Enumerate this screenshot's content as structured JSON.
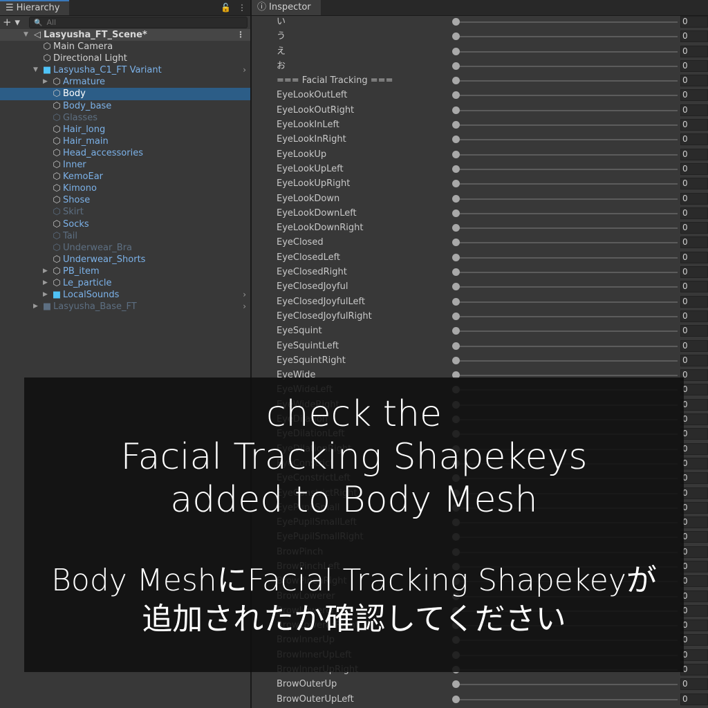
{
  "hierarchy": {
    "tab_label": "Hierarchy",
    "search_placeholder": "All",
    "rows": [
      {
        "label": "Lasyusha_FT_Scene*",
        "indent": 0,
        "icon": "unity",
        "arrow": "down",
        "style": "scene"
      },
      {
        "label": "Main Camera",
        "indent": 1,
        "icon": "cube",
        "arrow": "",
        "style": ""
      },
      {
        "label": "Directional Light",
        "indent": 1,
        "icon": "cube",
        "arrow": "",
        "style": ""
      },
      {
        "label": "Lasyusha_C1_FT Variant",
        "indent": 1,
        "icon": "prefab",
        "arrow": "down",
        "style": "blue",
        "chev": true
      },
      {
        "label": "Armature",
        "indent": 2,
        "icon": "cube",
        "arrow": "right",
        "style": "blue"
      },
      {
        "label": "Body",
        "indent": 2,
        "icon": "cube",
        "arrow": "",
        "style": "sel"
      },
      {
        "label": "Body_base",
        "indent": 2,
        "icon": "cube",
        "arrow": "",
        "style": "blue"
      },
      {
        "label": "Glasses",
        "indent": 2,
        "icon": "cube",
        "arrow": "",
        "style": "dim"
      },
      {
        "label": "Hair_long",
        "indent": 2,
        "icon": "cube",
        "arrow": "",
        "style": "blue"
      },
      {
        "label": "Hair_main",
        "indent": 2,
        "icon": "cube",
        "arrow": "",
        "style": "blue"
      },
      {
        "label": "Head_accessories",
        "indent": 2,
        "icon": "cube",
        "arrow": "",
        "style": "blue"
      },
      {
        "label": "Inner",
        "indent": 2,
        "icon": "cube",
        "arrow": "",
        "style": "blue"
      },
      {
        "label": "KemoEar",
        "indent": 2,
        "icon": "cube",
        "arrow": "",
        "style": "blue"
      },
      {
        "label": "Kimono",
        "indent": 2,
        "icon": "cube",
        "arrow": "",
        "style": "blue"
      },
      {
        "label": "Shose",
        "indent": 2,
        "icon": "cube",
        "arrow": "",
        "style": "blue"
      },
      {
        "label": "Skirt",
        "indent": 2,
        "icon": "cube",
        "arrow": "",
        "style": "dim"
      },
      {
        "label": "Socks",
        "indent": 2,
        "icon": "cube",
        "arrow": "",
        "style": "blue"
      },
      {
        "label": "Tail",
        "indent": 2,
        "icon": "cube",
        "arrow": "",
        "style": "dim"
      },
      {
        "label": "Underwear_Bra",
        "indent": 2,
        "icon": "cube",
        "arrow": "",
        "style": "dim"
      },
      {
        "label": "Underwear_Shorts",
        "indent": 2,
        "icon": "cube",
        "arrow": "",
        "style": "blue"
      },
      {
        "label": "PB_item",
        "indent": 2,
        "icon": "cube",
        "arrow": "right",
        "style": "blue"
      },
      {
        "label": "Le_particle",
        "indent": 2,
        "icon": "cube",
        "arrow": "right",
        "style": "blue"
      },
      {
        "label": "LocalSounds",
        "indent": 2,
        "icon": "prefab",
        "arrow": "right",
        "style": "blue",
        "chev": true
      },
      {
        "label": "Lasyusha_Base_FT",
        "indent": 1,
        "icon": "prefab",
        "arrow": "right",
        "style": "dim",
        "chev": true
      }
    ]
  },
  "inspector": {
    "tab_label": "Inspector",
    "blendshapes": [
      {
        "name": "い",
        "value": "0"
      },
      {
        "name": "う",
        "value": "0"
      },
      {
        "name": "え",
        "value": "0"
      },
      {
        "name": "お",
        "value": "0"
      },
      {
        "name": "=== Facial Tracking ===",
        "value": "0"
      },
      {
        "name": "EyeLookOutLeft",
        "value": "0"
      },
      {
        "name": "EyeLookOutRight",
        "value": "0"
      },
      {
        "name": "EyeLookInLeft",
        "value": "0"
      },
      {
        "name": "EyeLookInRight",
        "value": "0"
      },
      {
        "name": "EyeLookUp",
        "value": "0"
      },
      {
        "name": "EyeLookUpLeft",
        "value": "0"
      },
      {
        "name": "EyeLookUpRight",
        "value": "0"
      },
      {
        "name": "EyeLookDown",
        "value": "0"
      },
      {
        "name": "EyeLookDownLeft",
        "value": "0"
      },
      {
        "name": "EyeLookDownRight",
        "value": "0"
      },
      {
        "name": "EyeClosed",
        "value": "0"
      },
      {
        "name": "EyeClosedLeft",
        "value": "0"
      },
      {
        "name": "EyeClosedRight",
        "value": "0"
      },
      {
        "name": "EyeClosedJoyful",
        "value": "0"
      },
      {
        "name": "EyeClosedJoyfulLeft",
        "value": "0"
      },
      {
        "name": "EyeClosedJoyfulRight",
        "value": "0"
      },
      {
        "name": "EyeSquint",
        "value": "0"
      },
      {
        "name": "EyeSquintLeft",
        "value": "0"
      },
      {
        "name": "EyeSquintRight",
        "value": "0"
      },
      {
        "name": "EyeWide",
        "value": "0"
      },
      {
        "name": "EyeWideLeft",
        "value": "0"
      },
      {
        "name": "EyeWideRight",
        "value": "0"
      },
      {
        "name": "EyeDilation",
        "value": "0"
      },
      {
        "name": "EyeDilationLeft",
        "value": "0"
      },
      {
        "name": "EyeDilationRight",
        "value": "0"
      },
      {
        "name": "EyeConstrict",
        "value": "0"
      },
      {
        "name": "EyeConstrictLeft",
        "value": "0"
      },
      {
        "name": "EyeConstrictRight",
        "value": "0"
      },
      {
        "name": "EyePupilSmall",
        "value": "0"
      },
      {
        "name": "EyePupilSmallLeft",
        "value": "0"
      },
      {
        "name": "EyePupilSmallRight",
        "value": "0"
      },
      {
        "name": "BrowPinch",
        "value": "0"
      },
      {
        "name": "BrowPinchLeft",
        "value": "0"
      },
      {
        "name": "BrowPinchRight",
        "value": "0"
      },
      {
        "name": "BrowLowerer",
        "value": "0"
      },
      {
        "name": "BrowLowererLeft",
        "value": "0"
      },
      {
        "name": "BrowLowererRight",
        "value": "0"
      },
      {
        "name": "BrowInnerUp",
        "value": "0"
      },
      {
        "name": "BrowInnerUpLeft",
        "value": "0"
      },
      {
        "name": "BrowInnerUpRight",
        "value": "0"
      },
      {
        "name": "BrowOuterUp",
        "value": "0"
      },
      {
        "name": "BrowOuterUpLeft",
        "value": "0"
      }
    ]
  },
  "overlay": {
    "english_lines": [
      "check the",
      "Facial Tracking Shapekeys",
      "added to Body Mesh"
    ],
    "japanese_lines": [
      "Body MeshにFacial Tracking Shapekeyが",
      "追加されたか確認してください"
    ]
  }
}
